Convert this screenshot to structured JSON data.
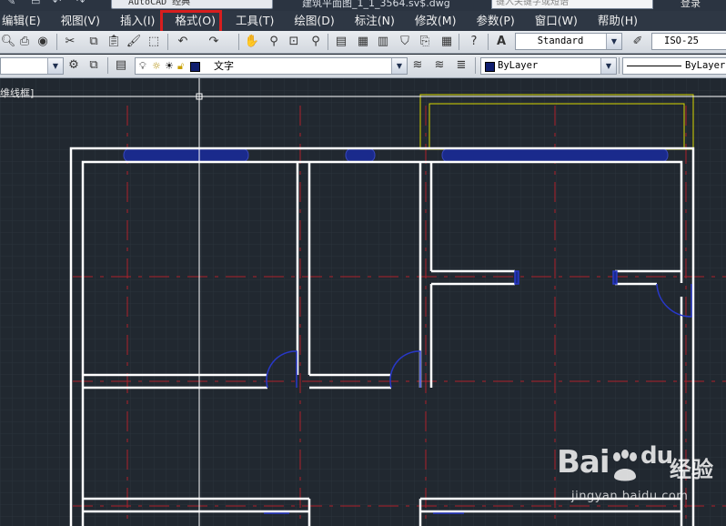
{
  "title_bar": {
    "workspace_value": "AutoCAD 经典",
    "document_title": "建筑平面图_1_1_3564.sv$.dwg",
    "search_placeholder": "键入关键字或短语",
    "login_label": "登录"
  },
  "menu": {
    "items": [
      {
        "label": "编辑(E)"
      },
      {
        "label": "视图(V)"
      },
      {
        "label": "插入(I)"
      },
      {
        "label": "格式(O)",
        "highlighted": true
      },
      {
        "label": "工具(T)"
      },
      {
        "label": "绘图(D)"
      },
      {
        "label": "标注(N)"
      },
      {
        "label": "修改(M)"
      },
      {
        "label": "参数(P)"
      },
      {
        "label": "窗口(W)"
      },
      {
        "label": "帮助(H)"
      }
    ],
    "highlight_color": "#d81e1e"
  },
  "standard_toolbar": {
    "text_style_value": "Standard",
    "dim_style_value": "ISO-25",
    "icons": [
      "open-icon",
      "plot-icon",
      "preview-icon",
      "publish-icon",
      "cut-icon",
      "copy-icon",
      "paste-icon",
      "match-properties-icon",
      "block-editor-icon",
      "undo-icon",
      "redo-icon",
      "pan-icon",
      "zoom-realtime-icon",
      "zoom-window-icon",
      "zoom-previous-icon",
      "properties-icon",
      "design-center-icon",
      "tool-palettes-icon",
      "sheet-set-icon",
      "markup-icon",
      "calculator-icon",
      "help-icon",
      "text-style-icon",
      "dim-style-icon"
    ]
  },
  "layers_toolbar": {
    "layer_value": "文字",
    "color_value": "ByLayer",
    "linetype_value": "ByLayer",
    "layer_color": "#101e6e"
  },
  "drawing": {
    "viewport_label": "维线框]",
    "background_color": "#212830",
    "wall_color": "#ffffff",
    "window_color": "#1a2a8c",
    "axis_color": "#b0202a",
    "crosshair_color": "#ffffff",
    "selection_color": "#d8d800"
  },
  "watermark": {
    "brand": "Bai",
    "brand_tail": "du",
    "chinese": "经验",
    "url": "jingyan.baidu.com"
  }
}
